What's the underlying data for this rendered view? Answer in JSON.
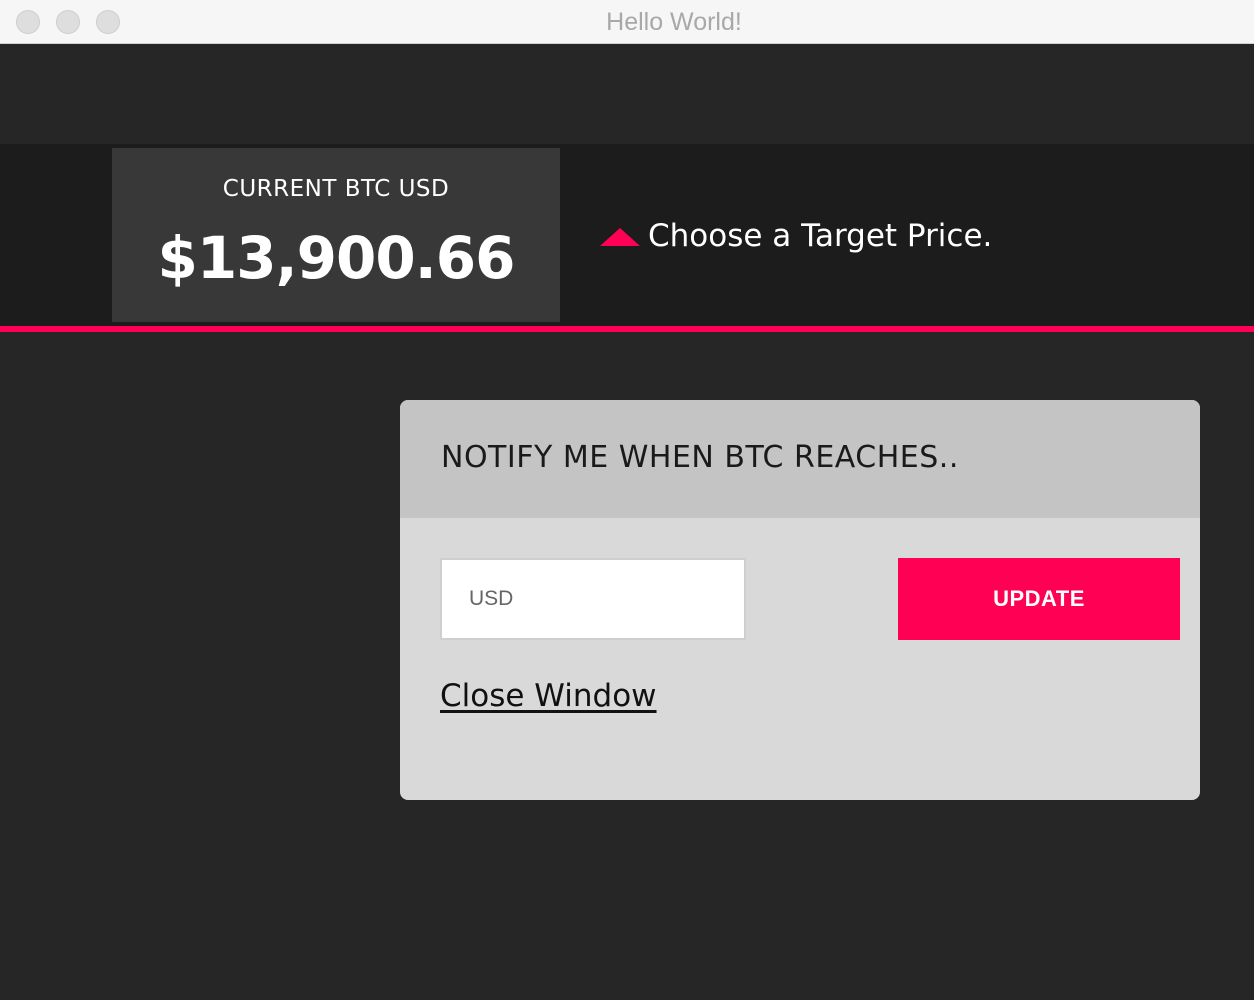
{
  "window": {
    "title": "Hello World!"
  },
  "ticker": {
    "label": "CURRENT BTC USD",
    "price": "$13,900.66"
  },
  "target": {
    "icon": "triangle-up-icon",
    "message": "Choose a Target Price."
  },
  "notify": {
    "title": "NOTIFY ME WHEN BTC REACHES..",
    "input_placeholder": "USD",
    "input_value": "",
    "update_label": "UPDATE",
    "close_label": "Close Window"
  },
  "colors": {
    "accent": "#ff0055",
    "background": "#262626",
    "header_band": "#1c1c1c",
    "price_box": "#383838",
    "card": "#d9d9d9",
    "card_header": "#c4c4c4"
  }
}
